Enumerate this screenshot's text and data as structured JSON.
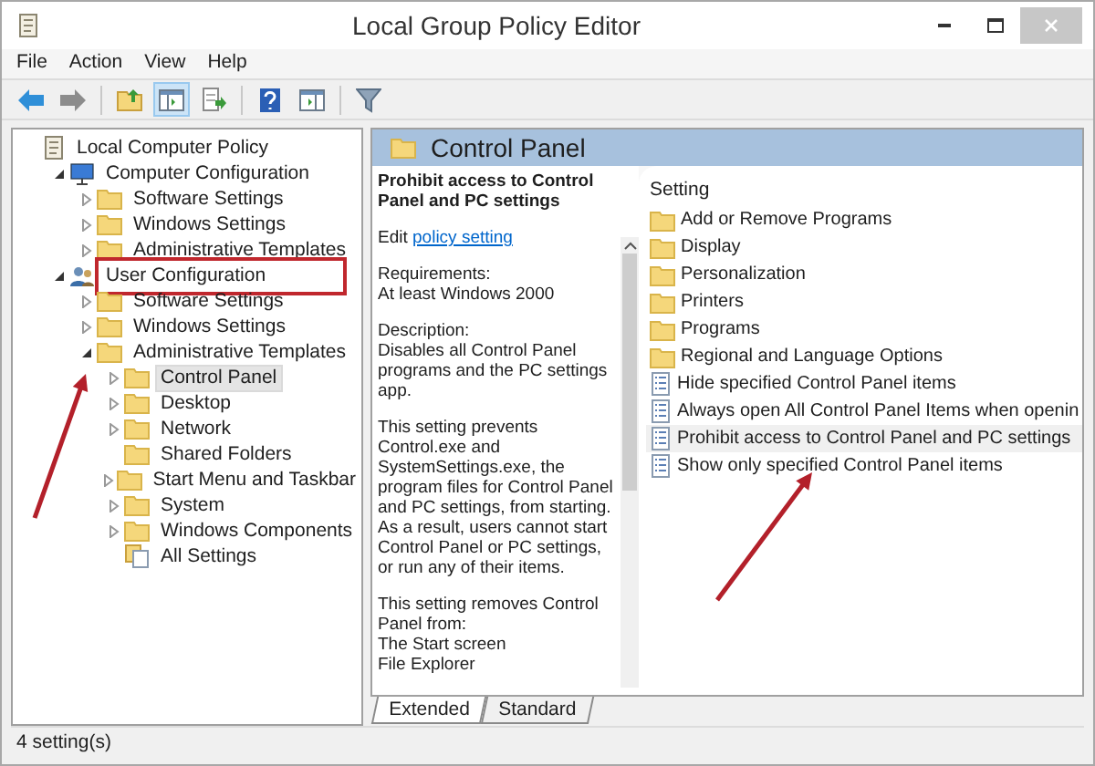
{
  "window": {
    "title": "Local Group Policy Editor"
  },
  "menu": [
    "File",
    "Action",
    "View",
    "Help"
  ],
  "toolbar": [
    {
      "kind": "back",
      "pressed": false
    },
    {
      "kind": "forward",
      "pressed": false
    },
    {
      "kind": "sep"
    },
    {
      "kind": "up",
      "pressed": false
    },
    {
      "kind": "tree",
      "pressed": true
    },
    {
      "kind": "export",
      "pressed": false
    },
    {
      "kind": "sep"
    },
    {
      "kind": "help",
      "pressed": false
    },
    {
      "kind": "view",
      "pressed": false
    },
    {
      "kind": "sep"
    },
    {
      "kind": "filter",
      "pressed": false
    }
  ],
  "tree": [
    {
      "label": "Local Computer Policy",
      "kind": "policy",
      "selected": false,
      "highlighted": false,
      "children": [
        {
          "label": "Computer Configuration",
          "kind": "computer",
          "expanded": true,
          "selected": false,
          "highlighted": false,
          "children": [
            {
              "label": "Software Settings",
              "kind": "folder",
              "expanded": false,
              "selected": false,
              "highlighted": false
            },
            {
              "label": "Windows Settings",
              "kind": "folder",
              "expanded": false,
              "selected": false,
              "highlighted": false
            },
            {
              "label": "Administrative Templates",
              "kind": "folder",
              "expanded": false,
              "selected": false,
              "highlighted": false
            }
          ]
        },
        {
          "label": "User Configuration",
          "kind": "user",
          "expanded": true,
          "selected": false,
          "highlighted": true,
          "children": [
            {
              "label": "Software Settings",
              "kind": "folder",
              "expanded": false,
              "selected": false,
              "highlighted": false
            },
            {
              "label": "Windows Settings",
              "kind": "folder",
              "expanded": false,
              "selected": false,
              "highlighted": false
            },
            {
              "label": "Administrative Templates",
              "kind": "folder",
              "expanded": true,
              "selected": false,
              "highlighted": false,
              "children": [
                {
                  "label": "Control Panel",
                  "kind": "folder",
                  "expanded": false,
                  "selected": true,
                  "highlighted": false
                },
                {
                  "label": "Desktop",
                  "kind": "folder",
                  "expanded": false,
                  "selected": false,
                  "highlighted": false
                },
                {
                  "label": "Network",
                  "kind": "folder",
                  "expanded": false,
                  "selected": false,
                  "highlighted": false
                },
                {
                  "label": "Shared Folders",
                  "kind": "folder",
                  "selected": false,
                  "highlighted": false
                },
                {
                  "label": "Start Menu and Taskbar",
                  "kind": "folder",
                  "expanded": false,
                  "selected": false,
                  "highlighted": false
                },
                {
                  "label": "System",
                  "kind": "folder",
                  "expanded": false,
                  "selected": false,
                  "highlighted": false
                },
                {
                  "label": "Windows Components",
                  "kind": "folder",
                  "expanded": false,
                  "selected": false,
                  "highlighted": false
                },
                {
                  "label": "All Settings",
                  "kind": "all",
                  "selected": false,
                  "highlighted": false
                }
              ]
            }
          ]
        }
      ]
    }
  ],
  "pane": {
    "title": "Control Panel",
    "heading": "Prohibit access to Control Panel and PC settings",
    "edit_prefix": "Edit",
    "edit_link": "policy setting",
    "paragraphs": [
      [
        "Requirements:",
        "At least Windows 2000"
      ],
      [
        "Description:",
        "Disables all Control Panel programs and the PC settings app."
      ],
      [
        "This setting prevents Control.exe and SystemSettings.exe, the program files for Control Panel and PC settings, from starting. As a result, users cannot start Control Panel or PC settings, or run any of their items."
      ],
      [
        "This setting removes Control Panel from:",
        "The Start screen",
        "File Explorer"
      ]
    ],
    "column": "Setting",
    "settings": [
      {
        "label": "Add or Remove Programs",
        "kind": "folder",
        "selected": false
      },
      {
        "label": "Display",
        "kind": "folder",
        "selected": false
      },
      {
        "label": "Personalization",
        "kind": "folder",
        "selected": false
      },
      {
        "label": "Printers",
        "kind": "folder",
        "selected": false
      },
      {
        "label": "Programs",
        "kind": "folder",
        "selected": false
      },
      {
        "label": "Regional and Language Options",
        "kind": "folder",
        "selected": false
      },
      {
        "label": "Hide specified Control Panel items",
        "kind": "setting",
        "selected": false
      },
      {
        "label": "Always open All Control Panel Items when openin",
        "kind": "setting",
        "selected": false
      },
      {
        "label": "Prohibit access to Control Panel and PC settings",
        "kind": "setting",
        "selected": true
      },
      {
        "label": "Show only specified Control Panel items",
        "kind": "setting",
        "selected": false
      }
    ],
    "tabs": [
      {
        "label": "Extended",
        "selected": true
      },
      {
        "label": "Standard",
        "selected": false
      }
    ]
  },
  "status_bar": "4 setting(s)"
}
